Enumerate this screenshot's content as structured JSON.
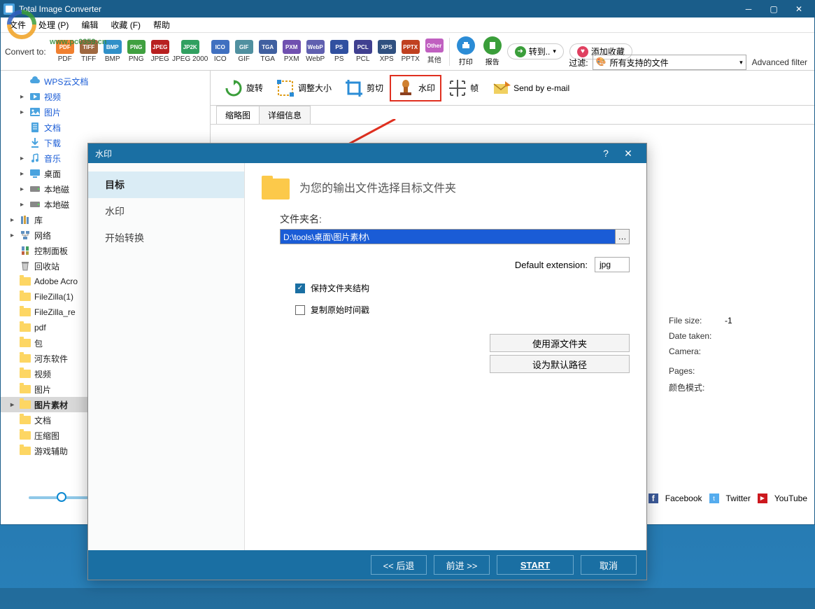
{
  "window": {
    "title": "Total Image Converter",
    "watermark_url": "www.pc0359.cn"
  },
  "menu": {
    "file": "文件",
    "process": "处理 (P)",
    "edit": "编辑",
    "favorites": "收藏 (F)",
    "help": "帮助"
  },
  "convert": {
    "label": "Convert to:",
    "formats": [
      {
        "id": "PDF",
        "color": "#f08030"
      },
      {
        "id": "TIFF",
        "color": "#a06840"
      },
      {
        "id": "BMP",
        "color": "#3090c8"
      },
      {
        "id": "PNG",
        "color": "#40a040"
      },
      {
        "id": "JPEG",
        "color": "#b82020"
      },
      {
        "id": "JPEG 2000",
        "short": "JP2K",
        "color": "#30a060",
        "wide": true
      },
      {
        "id": "ICO",
        "color": "#4070c0"
      },
      {
        "id": "GIF",
        "color": "#5090a0"
      },
      {
        "id": "TGA",
        "color": "#4060a0"
      },
      {
        "id": "PXM",
        "color": "#7050b0"
      },
      {
        "id": "WebP",
        "color": "#6060b0"
      },
      {
        "id": "PS",
        "color": "#3050a0"
      },
      {
        "id": "PCL",
        "color": "#404090"
      },
      {
        "id": "XPS",
        "color": "#305080"
      },
      {
        "id": "PPTX",
        "color": "#c04020"
      }
    ],
    "other": "其他",
    "print": "打印",
    "report": "报告",
    "go": "转到..",
    "addfav": "添加收藏",
    "filter_label": "过滤:",
    "filter_value": "所有支持的文件",
    "advanced": "Advanced filter"
  },
  "tree": [
    {
      "text": "WPS云文档",
      "icon": "cloud",
      "color": "blue",
      "arrow": " "
    },
    {
      "text": "视频",
      "icon": "video",
      "color": "blue",
      "arrow": "▸"
    },
    {
      "text": "图片",
      "icon": "image",
      "color": "blue",
      "arrow": "▸"
    },
    {
      "text": "文档",
      "icon": "doc",
      "color": "blue",
      "arrow": " "
    },
    {
      "text": "下载",
      "icon": "download",
      "color": "blue",
      "arrow": " "
    },
    {
      "text": "音乐",
      "icon": "music",
      "color": "blue",
      "arrow": "▸"
    },
    {
      "text": "桌面",
      "icon": "desktop",
      "arrow": "▸"
    },
    {
      "text": "本地磁",
      "icon": "disk",
      "arrow": "▸"
    },
    {
      "text": "本地磁",
      "icon": "disk",
      "arrow": "▸"
    },
    {
      "text": "库",
      "icon": "lib",
      "arrow": "▸",
      "indent": -1
    },
    {
      "text": "网络",
      "icon": "net",
      "arrow": "▸",
      "indent": -1
    },
    {
      "text": "控制面板",
      "icon": "ctrl",
      "arrow": " ",
      "indent": -1
    },
    {
      "text": "回收站",
      "icon": "trash",
      "arrow": " ",
      "indent": -1
    },
    {
      "text": "Adobe Acro",
      "icon": "folder",
      "arrow": " ",
      "indent": -1
    },
    {
      "text": "FileZilla(1)",
      "icon": "folder",
      "arrow": " ",
      "indent": -1
    },
    {
      "text": "FileZilla_re",
      "icon": "folder",
      "arrow": " ",
      "indent": -1
    },
    {
      "text": "pdf",
      "icon": "folder",
      "arrow": " ",
      "indent": -1
    },
    {
      "text": "包",
      "icon": "folder",
      "arrow": " ",
      "indent": -1
    },
    {
      "text": "河东软件",
      "icon": "folder",
      "arrow": " ",
      "indent": -1
    },
    {
      "text": "视频",
      "icon": "folder",
      "arrow": " ",
      "indent": -1
    },
    {
      "text": "图片",
      "icon": "folder",
      "arrow": " ",
      "indent": -1
    },
    {
      "text": "图片素材",
      "icon": "folder",
      "arrow": "▸",
      "selected": true,
      "indent": -1
    },
    {
      "text": "文档",
      "icon": "folder",
      "arrow": " ",
      "indent": -1
    },
    {
      "text": "压缩图",
      "icon": "folder",
      "arrow": " ",
      "indent": -1
    },
    {
      "text": "游戏辅助",
      "icon": "folder",
      "arrow": " ",
      "indent": -1
    }
  ],
  "toolbar2": {
    "rotate": "旋转",
    "resize": "调整大小",
    "crop": "剪切",
    "watermark": "水印",
    "frame": "帧",
    "email": "Send by e-mail"
  },
  "subtabs": {
    "thumb": "缩略图",
    "detail": "详细信息"
  },
  "info": {
    "filesize_k": "File size:",
    "filesize_v": "-1",
    "date_k": "Date taken:",
    "camera_k": "Camera:",
    "pages_k": "Pages:",
    "colormode_k": "颜色模式:"
  },
  "social": {
    "fb": "Facebook",
    "tw": "Twitter",
    "yt": "YouTube"
  },
  "dialog": {
    "title": "水印",
    "side": {
      "target": "目标",
      "watermark": "水印",
      "start": "开始转换"
    },
    "header": "为您的输出文件选择目标文件夹",
    "folder_label": "文件夹名:",
    "folder_value": "D:\\tools\\桌面\\图片素材\\",
    "ext_label": "Default extension:",
    "ext_value": "jpg",
    "keep_structure": "保持文件夹结构",
    "copy_timestamp": "复制原始时间戳",
    "use_source": "使用源文件夹",
    "set_default": "设为默认路径",
    "back": "<< 后退",
    "forward": "前进 >>",
    "start_btn": "START",
    "cancel": "取消"
  }
}
